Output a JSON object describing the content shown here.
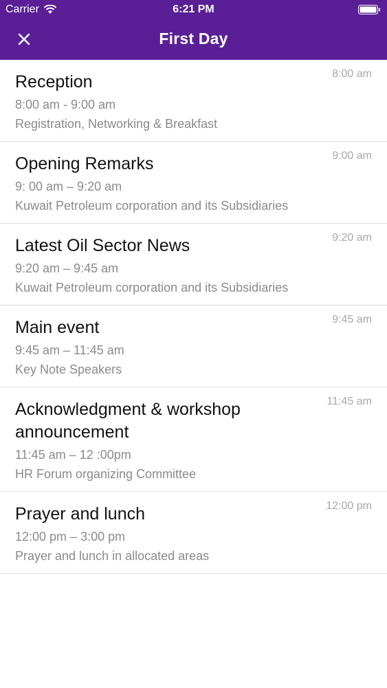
{
  "status_bar": {
    "carrier": "Carrier",
    "time": "6:21 PM"
  },
  "nav": {
    "title": "First Day",
    "close_icon": "close-icon"
  },
  "colors": {
    "header_bg": "#5a1f96",
    "title_text": "#111111",
    "secondary_text": "#8a8a8a"
  },
  "schedule": [
    {
      "title": "Reception",
      "range": "8:00 am - 9:00 am",
      "description": "Registration, Networking & Breakfast",
      "time": "8:00 am"
    },
    {
      "title": "Opening Remarks",
      "range": "9: 00 am – 9:20 am",
      "description": "Kuwait Petroleum corporation and its Subsidiaries",
      "time": "9:00 am"
    },
    {
      "title": "Latest Oil Sector News",
      "range": "9:20 am – 9:45 am",
      "description": "Kuwait Petroleum corporation and its Subsidiaries",
      "time": "9:20 am"
    },
    {
      "title": "Main event",
      "range": "9:45 am – 11:45 am",
      "description": "Key Note Speakers",
      "time": "9:45 am"
    },
    {
      "title": "Acknowledgment & workshop announcement",
      "range": "11:45 am – 12 :00pm",
      "description": "HR Forum organizing Committee",
      "time": "11:45 am"
    },
    {
      "title": "Prayer and lunch",
      "range": "12:00 pm – 3:00 pm",
      "description": "Prayer and lunch in allocated areas",
      "time": "12:00 pm"
    }
  ]
}
